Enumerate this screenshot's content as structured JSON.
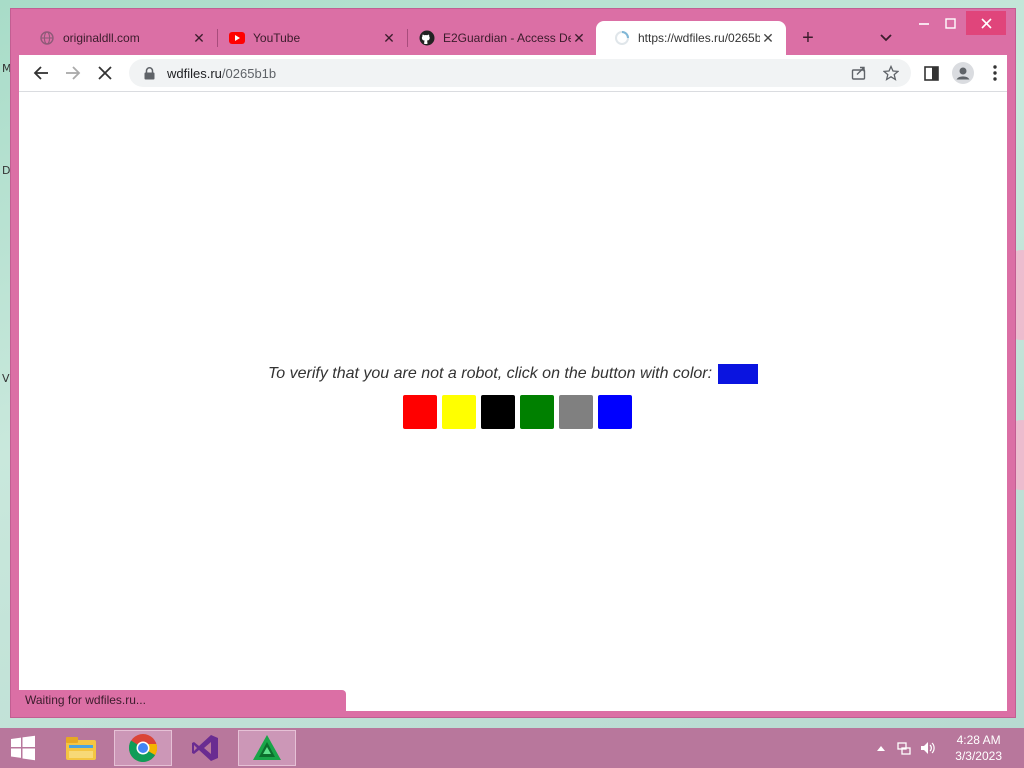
{
  "browser": {
    "tabs": [
      {
        "label": "originaldll.com",
        "icon": "globe-icon"
      },
      {
        "label": "YouTube",
        "icon": "youtube-icon"
      },
      {
        "label": "E2Guardian - Access De",
        "icon": "github-icon"
      },
      {
        "label": "https://wdfiles.ru/0265b",
        "icon": "loading-spinner-icon",
        "active": true
      }
    ],
    "address": {
      "domain": "wdfiles.ru",
      "path": "/0265b1b"
    },
    "status_text": "Waiting for wdfiles.ru..."
  },
  "page": {
    "prompt": "To verify that you are not a robot, click on the button with color:",
    "target_color": "#0a14e0",
    "swatches": [
      {
        "name": "red",
        "color": "#ff0000"
      },
      {
        "name": "yellow",
        "color": "#ffff00"
      },
      {
        "name": "black",
        "color": "#000000"
      },
      {
        "name": "green",
        "color": "#008000"
      },
      {
        "name": "gray",
        "color": "#808080"
      },
      {
        "name": "blue",
        "color": "#0000ff"
      }
    ]
  },
  "taskbar": {
    "apps": [
      "start-icon",
      "file-explorer-icon",
      "chrome-icon",
      "visual-studio-icon",
      "green-triangle-app-icon"
    ],
    "clock": {
      "time": "4:28 AM",
      "date": "3/3/2023"
    }
  },
  "desktop": {
    "labels": [
      "M",
      "D",
      "V"
    ]
  },
  "theme": {
    "frame": "#db6fa5",
    "taskbar": "#b8779c"
  }
}
